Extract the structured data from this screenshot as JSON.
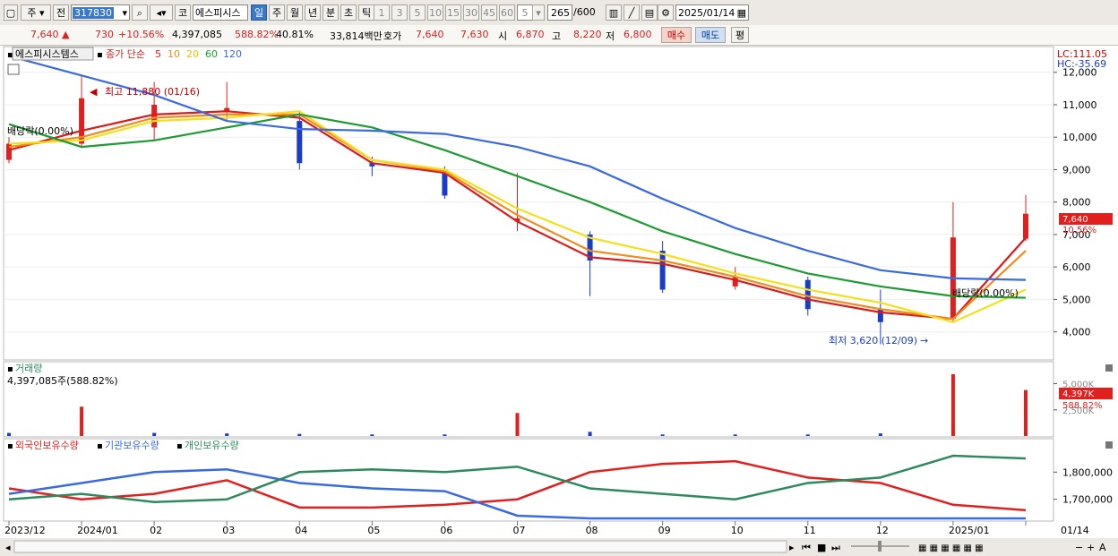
{
  "toolbar": {
    "market": "주",
    "prev": "전",
    "code": "317830",
    "name": "에스피시스",
    "periods": [
      "일",
      "주",
      "월",
      "년",
      "분",
      "초",
      "틱"
    ],
    "selected_period": "일",
    "intervals": [
      "1",
      "3",
      "5",
      "10",
      "15",
      "30",
      "45",
      "60"
    ],
    "interval_value": "5",
    "count_value": "265",
    "count_max": "/600",
    "date": "2025/01/14",
    "code_prefix": "코"
  },
  "quote": {
    "price": "7,640",
    "change": "730",
    "change_pct": "+10.56%",
    "volume": "4,397,085",
    "volume_ratio": "588.82%",
    "turnover": "40.81%",
    "amount": "33,814백만",
    "ask_label": "호가",
    "ask": "7,640",
    "bid": "7,630",
    "open_label": "시",
    "open": "6,870",
    "high_label": "고",
    "high": "8,220",
    "low_label": "저",
    "low": "6,800",
    "buy_label": "매수",
    "sell_label": "매도",
    "avg_label": "평"
  },
  "price_panel": {
    "name_label": "에스피시스템스",
    "ma_title": "종가 단순",
    "ma_periods": [
      "5",
      "10",
      "20",
      "60",
      "120"
    ],
    "lc_label": "LC:111.05",
    "hc_label": "HC:-35.69",
    "y_ticks": [
      "12,000",
      "11,000",
      "10,000",
      "9,000",
      "8,000",
      "7,000",
      "6,000",
      "5,000",
      "4,000"
    ],
    "high_note": "최고 11,880 (01/16)",
    "low_note": "최저 3,620 (12/09)",
    "dividend_note": "배당락(0.00%)",
    "dividend_note2": "배당락(0.00%)",
    "last_price_tag": "7,640",
    "last_pct_tag": "10.56%"
  },
  "volume_panel": {
    "title": "거래량",
    "value_text": "4,397,085주(588.82%)",
    "y_ticks": [
      "5,000K",
      "2,500K"
    ],
    "tag_value": "4,397K",
    "tag_pct": "588.82%"
  },
  "holding_panel": {
    "foreign_label": "외국인보유수량",
    "inst_label": "기관보유수량",
    "retail_label": "개인보유수량",
    "y_ticks": [
      "1,800,000",
      "1,700,000"
    ]
  },
  "x_axis": {
    "labels": [
      "2023/12",
      "2024/01",
      "02",
      "03",
      "04",
      "05",
      "06",
      "07",
      "08",
      "09",
      "10",
      "11",
      "12",
      "2025/01",
      "01/14"
    ]
  },
  "colors": {
    "up": "#e0201e",
    "down": "#1a3cc8",
    "ma5": "#d81c1c",
    "ma10": "#f08c1e",
    "ma20": "#f4e01a",
    "ma60": "#1e9a32",
    "ma120": "#3a6ae0",
    "foreign": "#e0201e",
    "inst": "#3a6ae0",
    "retail": "#2e8a5e"
  },
  "chart_data": [
    {
      "type": "line",
      "title": "에스피시스템스 종가 단순",
      "x": [
        "2023/12",
        "2024/01",
        "2024/02",
        "2024/03",
        "2024/04",
        "2024/05",
        "2024/06",
        "2024/07",
        "2024/08",
        "2024/09",
        "2024/10",
        "2024/11",
        "2024/12",
        "2025/01",
        "2025/01/14"
      ],
      "series": [
        {
          "name": "5",
          "values": [
            9600,
            10200,
            10700,
            10800,
            10600,
            9200,
            8900,
            7400,
            6300,
            6100,
            5600,
            5000,
            4600,
            4400,
            6900
          ]
        },
        {
          "name": "10",
          "values": [
            9700,
            10000,
            10600,
            10700,
            10700,
            9300,
            8950,
            7600,
            6500,
            6200,
            5700,
            5100,
            4700,
            4400,
            6500
          ]
        },
        {
          "name": "20",
          "values": [
            9800,
            9900,
            10500,
            10600,
            10800,
            9300,
            9000,
            7800,
            6900,
            6400,
            5800,
            5300,
            4900,
            4300,
            5300
          ]
        },
        {
          "name": "60",
          "values": [
            10400,
            9700,
            9900,
            10300,
            10700,
            10300,
            9600,
            8800,
            8000,
            7100,
            6400,
            5800,
            5400,
            5100,
            5050
          ]
        },
        {
          "name": "120",
          "values": [
            12500,
            11900,
            11300,
            10500,
            10250,
            10200,
            10100,
            9700,
            9100,
            8100,
            7200,
            6500,
            5900,
            5650,
            5600
          ]
        }
      ],
      "candles": [
        {
          "x": "2023/12",
          "open": 9300,
          "high": 10000,
          "low": 9200,
          "close": 9800
        },
        {
          "x": "2024/01",
          "open": 9800,
          "high": 11880,
          "low": 9700,
          "close": 11200
        },
        {
          "x": "2024/02",
          "open": 10300,
          "high": 11700,
          "low": 9900,
          "close": 11000
        },
        {
          "x": "2024/03",
          "open": 10800,
          "high": 11700,
          "low": 10500,
          "close": 10900
        },
        {
          "x": "2024/04",
          "open": 10500,
          "high": 10800,
          "low": 9000,
          "close": 9200
        },
        {
          "x": "2024/05",
          "open": 9200,
          "high": 9400,
          "low": 8800,
          "close": 9100
        },
        {
          "x": "2024/06",
          "open": 9000,
          "high": 9100,
          "low": 8100,
          "close": 8200
        },
        {
          "x": "2024/07",
          "open": 7400,
          "high": 8900,
          "low": 7100,
          "close": 7500
        },
        {
          "x": "2024/08",
          "open": 7000,
          "high": 7100,
          "low": 5100,
          "close": 6200
        },
        {
          "x": "2024/09",
          "open": 6500,
          "high": 6800,
          "low": 5200,
          "close": 5300
        },
        {
          "x": "2024/10",
          "open": 5400,
          "high": 6000,
          "low": 5300,
          "close": 5700
        },
        {
          "x": "2024/11",
          "open": 5600,
          "high": 5700,
          "low": 4500,
          "close": 4700
        },
        {
          "x": "2024/12",
          "open": 4700,
          "high": 5300,
          "low": 3620,
          "close": 4300
        },
        {
          "x": "2025/01",
          "open": 4400,
          "high": 8000,
          "low": 4300,
          "close": 6910
        },
        {
          "x": "2025/01/14",
          "open": 6870,
          "high": 8220,
          "low": 6800,
          "close": 7640
        }
      ],
      "ylim": [
        3300,
        12600
      ],
      "y_scale": "linear",
      "grid": true,
      "legend": "top-left"
    },
    {
      "type": "bar",
      "title": "거래량",
      "categories": [
        "2023/12",
        "2024/01",
        "2024/02",
        "2024/03",
        "2024/04",
        "2024/05",
        "2024/06",
        "2024/07",
        "2024/08",
        "2024/09",
        "2024/10",
        "2024/11",
        "2024/12",
        "2025/01",
        "2025/01/14"
      ],
      "values": [
        300,
        2800,
        300,
        250,
        200,
        150,
        150,
        2200,
        400,
        150,
        150,
        150,
        250,
        5900,
        4397
      ],
      "unit": "K",
      "ylim": [
        0,
        6500
      ]
    },
    {
      "type": "line",
      "title": "보유수량",
      "x": [
        "2023/12",
        "2024/01",
        "2024/02",
        "2024/03",
        "2024/04",
        "2024/05",
        "2024/06",
        "2024/07",
        "2024/08",
        "2024/09",
        "2024/10",
        "2024/11",
        "2024/12",
        "2025/01",
        "2025/01/14"
      ],
      "series": [
        {
          "name": "외국인보유수량",
          "values": [
            1740000,
            1700000,
            1720000,
            1770000,
            1670000,
            1670000,
            1680000,
            1700000,
            1800000,
            1830000,
            1840000,
            1780000,
            1760000,
            1680000,
            1660000
          ]
        },
        {
          "name": "기관보유수량",
          "values": [
            1720000,
            1760000,
            1800000,
            1810000,
            1760000,
            1740000,
            1730000,
            1640000,
            1630000,
            1630000,
            1630000,
            1630000,
            1630000,
            1630000,
            1630000
          ]
        },
        {
          "name": "개인보유수량",
          "values": [
            1700000,
            1720000,
            1690000,
            1700000,
            1800000,
            1810000,
            1800000,
            1820000,
            1740000,
            1720000,
            1700000,
            1760000,
            1780000,
            1860000,
            1850000
          ]
        }
      ],
      "ylim": [
        1630000,
        1870000
      ]
    }
  ]
}
